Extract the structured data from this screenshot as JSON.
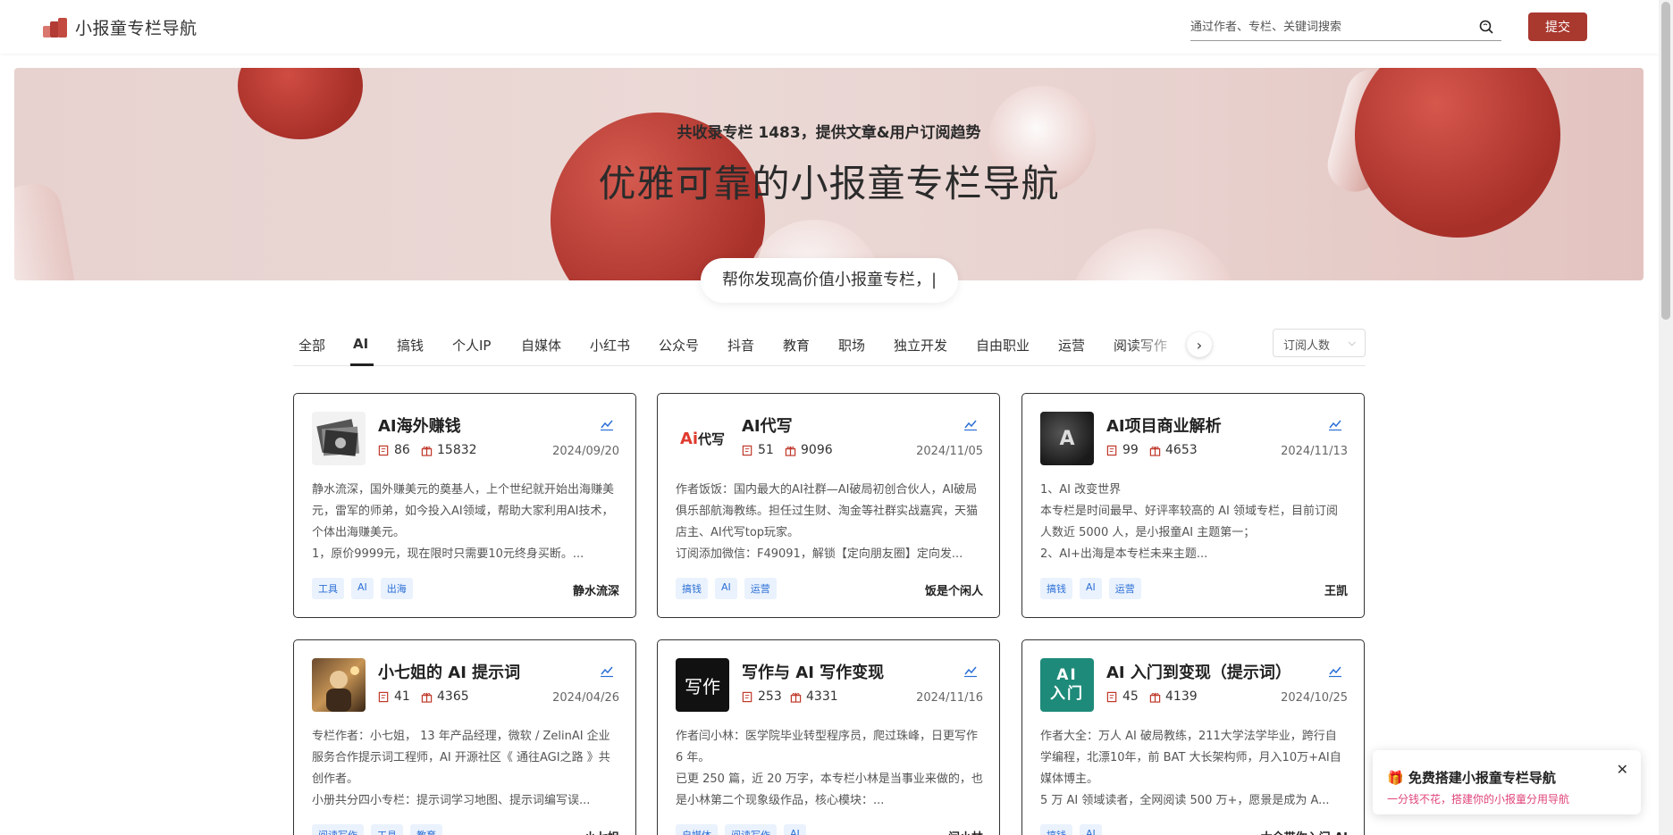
{
  "header": {
    "logo_text": "小报童专栏导航",
    "search_placeholder": "通过作者、专栏、关键词搜索",
    "submit_label": "提交"
  },
  "banner": {
    "subtitle": "共收录专栏 1483，提供文章&用户订阅趋势",
    "title": "优雅可靠的小报童专栏导航",
    "typed_text": "帮你发现高价值小报童专栏，|"
  },
  "tabs": [
    "全部",
    "AI",
    "搞钱",
    "个人IP",
    "自媒体",
    "小红书",
    "公众号",
    "抖音",
    "教育",
    "职场",
    "独立开发",
    "自由职业",
    "运营",
    "阅读写作"
  ],
  "active_tab": "AI",
  "sort": {
    "selected": "订阅人数"
  },
  "cards": [
    {
      "title": "AI海外赚钱",
      "articles": "86",
      "subscribers": "15832",
      "date": "2024/09/20",
      "desc": [
        "静水流深，国外赚美元的奠基人，上个世纪就开始出海赚美元，雷军的师弟，如今投入AI领域，帮助大家利用AI技术，个体出海赚美元。",
        "1，原价9999元，现在限时只需要10元终身买断。..."
      ],
      "tags": [
        "工具",
        "AI",
        "出海"
      ],
      "author": "静水流深",
      "thumb": "money-icon"
    },
    {
      "title": "AI代写",
      "articles": "51",
      "subscribers": "9096",
      "date": "2024/11/05",
      "desc": [
        "作者饭饭：国内最大的AI社群—AI破局初创合伙人，AI破局俱乐部航海教练。担任过生财、淘金等社群实战嘉宾，天猫店主、AI代写top玩家。",
        "订阅添加微信：F49091，解锁【定向朋友圈】定向发..."
      ],
      "tags": [
        "搞钱",
        "AI",
        "运营"
      ],
      "author": "饭是个闲人",
      "thumb_a": "Ai",
      "thumb_b": "代写"
    },
    {
      "title": "AI项目商业解析",
      "articles": "99",
      "subscribers": "4653",
      "date": "2024/11/13",
      "desc": [
        "1、AI 改变世界",
        "本专栏是时间最早、好评率较高的 AI 领域专栏，目前订阅人数近 5000 人，是小报童AI 主题第一；",
        "2、AI+出海是本专栏未来主题..."
      ],
      "tags": [
        "搞钱",
        "AI",
        "运营"
      ],
      "author": "王凯",
      "thumb_text": "A"
    },
    {
      "title": "小七姐的 AI 提示词",
      "articles": "41",
      "subscribers": "4365",
      "date": "2024/04/26",
      "desc": [
        "专栏作者：小七姐， 13 年产品经理，微软 / ZelinAI 企业服务合作提示词工程师，AI 开源社区《 通往AGI之路 》共创作者。",
        "小册共分四小专栏：提示词学习地图、提示词编写误..."
      ],
      "tags": [
        "阅读写作",
        "工具",
        "教育"
      ],
      "author": "小七姐",
      "thumb": "portrait-icon"
    },
    {
      "title": "写作与 AI 写作变现",
      "articles": "253",
      "subscribers": "4331",
      "date": "2024/11/16",
      "desc": [
        "作者闫小林：医学院毕业转型程序员，爬过珠峰，日更写作 6 年。",
        "已更 250 篇，近 20 万字，本专栏小林是当事业来做的，也是小林第二个现象级作品，核心模块：..."
      ],
      "tags": [
        "自媒体",
        "阅读写作",
        "AI"
      ],
      "author": "闫小林",
      "thumb_text": "写作"
    },
    {
      "title": "AI 入门到变现（提示词）",
      "articles": "45",
      "subscribers": "4139",
      "date": "2024/10/25",
      "desc": [
        "作者大全：万人 AI 破局教练，211大学法学毕业，跨行自学编程，北漂10年，前 BAT 大长架构师，月入10万+AI自媒体博主。",
        "5 万 AI 领域读者，全网阅读 500 万+，愿景是成为 A..."
      ],
      "tags": [
        "搞钱",
        "AI"
      ],
      "author": "大全带你入门 AI",
      "thumb_l1": "AI",
      "thumb_l2": "入门"
    }
  ],
  "promo": {
    "title": "🎁 免费搭建小报童专栏导航",
    "subtitle": "一分钱不花，搭建你的小报童分用导航",
    "close": "✕"
  },
  "colors": {
    "brand": "#a9382f",
    "tag_text": "#2b6fd6",
    "promo_sub": "#e0457b"
  }
}
